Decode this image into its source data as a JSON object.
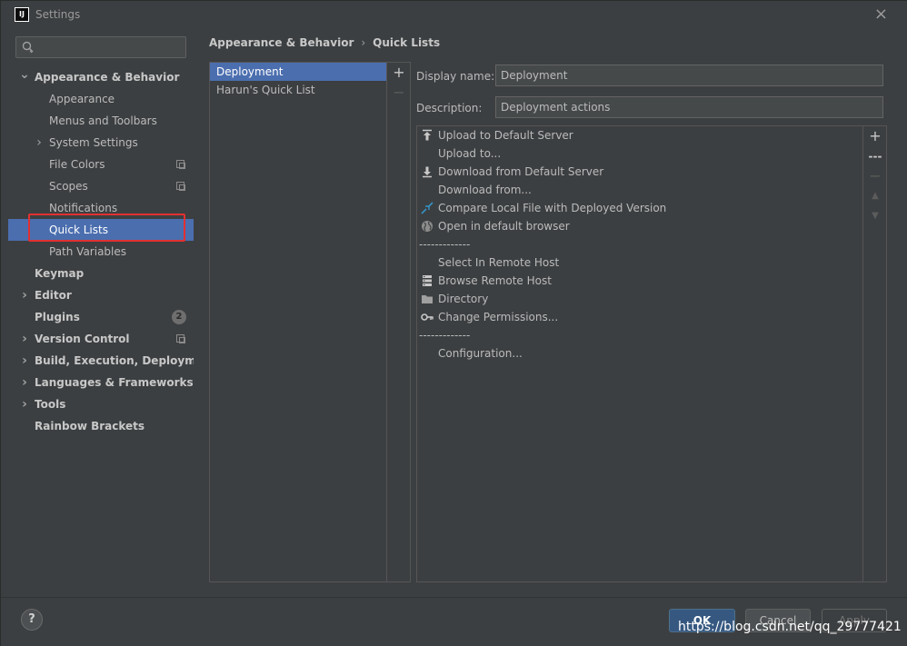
{
  "window": {
    "title": "Settings",
    "close_glyph": "×"
  },
  "search": {
    "placeholder": "",
    "icon": "search-icon"
  },
  "sidebar": {
    "items": [
      {
        "label": "Appearance & Behavior",
        "bold": true,
        "expanded": true
      },
      {
        "label": "Appearance"
      },
      {
        "label": "Menus and Toolbars"
      },
      {
        "label": "System Settings",
        "collapsed": true
      },
      {
        "label": "File Colors",
        "badge": "copy-icon"
      },
      {
        "label": "Scopes",
        "badge": "copy-icon"
      },
      {
        "label": "Notifications"
      },
      {
        "label": "Quick Lists",
        "selected": true
      },
      {
        "label": "Path Variables"
      },
      {
        "label": "Keymap",
        "bold": true
      },
      {
        "label": "Editor",
        "bold": true,
        "collapsed": true
      },
      {
        "label": "Plugins",
        "bold": true,
        "count": "2"
      },
      {
        "label": "Version Control",
        "bold": true,
        "collapsed": true,
        "badge": "copy-icon"
      },
      {
        "label": "Build, Execution, Deployment",
        "bold": true,
        "collapsed": true
      },
      {
        "label": "Languages & Frameworks",
        "bold": true,
        "collapsed": true
      },
      {
        "label": "Tools",
        "bold": true,
        "collapsed": true
      },
      {
        "label": "Rainbow Brackets",
        "bold": true
      }
    ]
  },
  "breadcrumb": {
    "parent": "Appearance & Behavior",
    "separator": "›",
    "current": "Quick Lists"
  },
  "quick_lists": {
    "entries": [
      "Deployment",
      "Harun's Quick List"
    ],
    "selected_index": 0,
    "add_glyph": "+",
    "remove_glyph": "−"
  },
  "form": {
    "display_name_label": "Display name:",
    "display_name_value": "Deployment",
    "description_label": "Description:",
    "description_value": "Deployment actions"
  },
  "actions": [
    {
      "label": "Upload to Default Server",
      "icon": "upload-icon"
    },
    {
      "label": "Upload to..."
    },
    {
      "label": "Download from Default Server",
      "icon": "download-icon"
    },
    {
      "label": "Download from..."
    },
    {
      "label": "Compare Local File with Deployed Version",
      "icon": "compare-icon"
    },
    {
      "label": "Open in default browser",
      "icon": "globe-icon"
    },
    {
      "label": "-------------",
      "separator": true
    },
    {
      "label": "Select In Remote Host"
    },
    {
      "label": "Browse Remote Host",
      "icon": "server-icon"
    },
    {
      "label": "Directory",
      "icon": "folder-icon"
    },
    {
      "label": "Change Permissions...",
      "icon": "key-icon"
    },
    {
      "label": "-------------",
      "separator": true
    },
    {
      "label": "Configuration..."
    }
  ],
  "action_tools": {
    "add": "+",
    "separator": "---",
    "remove": "−",
    "up": "▲",
    "down": "▼"
  },
  "footer": {
    "help": "?",
    "ok": "OK",
    "cancel": "Cancel",
    "apply": "Apply",
    "watermark": "https://blog.csdn.net/qq_29777421"
  },
  "colors": {
    "selection": "#4b6eaf",
    "highlight": "#e23030",
    "ok_button": "#365880"
  }
}
